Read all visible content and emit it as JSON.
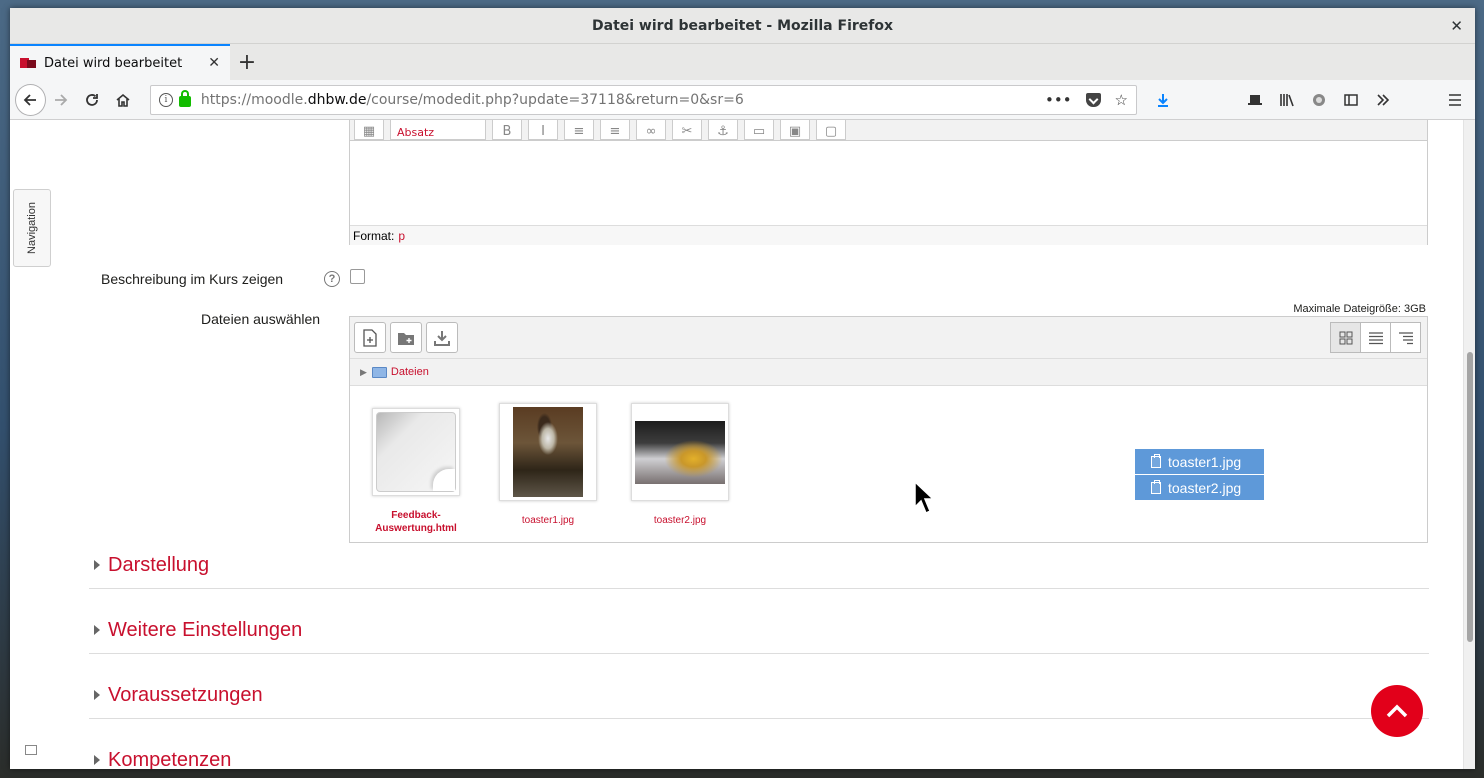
{
  "window": {
    "title": "Datei wird bearbeitet - Mozilla Firefox"
  },
  "tab": {
    "title": "Datei wird bearbeitet"
  },
  "urlbar": {
    "scheme": "https://moodle.",
    "host": "dhbw.de",
    "path": "/course/modedit.php?update=37118&return=0&sr=6"
  },
  "nav_drawer": {
    "label": "Navigation"
  },
  "editor": {
    "format_label": "Format:",
    "format_value": "p",
    "paragraph_select": "Absatz"
  },
  "form": {
    "show_description_label": "Beschreibung im Kurs zeigen",
    "show_description_checked": false,
    "files_label": "Dateien auswählen",
    "max_size": "Maximale Dateigröße: 3GB",
    "breadcrumb": "Dateien"
  },
  "files": [
    {
      "name": "Feedback-Auswertung.html",
      "kind": "document"
    },
    {
      "name": "toaster1.jpg",
      "kind": "photo"
    },
    {
      "name": "toaster2.jpg",
      "kind": "photo"
    }
  ],
  "dragging": [
    "toaster1.jpg",
    "toaster2.jpg"
  ],
  "sections": [
    {
      "title": "Darstellung"
    },
    {
      "title": "Weitere Einstellungen"
    },
    {
      "title": "Voraussetzungen"
    },
    {
      "title": "Kompetenzen"
    }
  ],
  "colors": {
    "accent": "#c8102e",
    "drag_highlight": "#5e99d9",
    "scroll_top_button": "#e2001a"
  }
}
